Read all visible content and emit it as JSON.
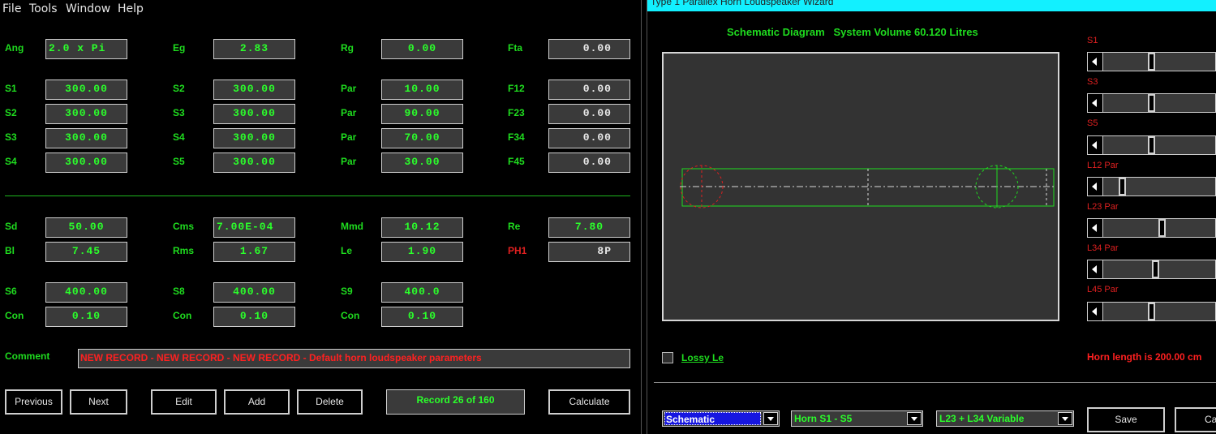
{
  "menu": [
    "File",
    "Tools",
    "Window",
    "Help"
  ],
  "params": {
    "ang_label": "Ang",
    "ang": "2.0 x Pi",
    "eg_label": "Eg",
    "eg": "2.83",
    "rg_label": "Rg",
    "rg": "0.00",
    "fta_label": "Fta",
    "fta": "0.00",
    "rows": [
      {
        "a_label": "S1",
        "a": "300.00",
        "b_label": "S2",
        "b": "300.00",
        "c_label": "Par",
        "c": "10.00",
        "d_label": "F12",
        "d": "0.00"
      },
      {
        "a_label": "S2",
        "a": "300.00",
        "b_label": "S3",
        "b": "300.00",
        "c_label": "Par",
        "c": "90.00",
        "d_label": "F23",
        "d": "0.00"
      },
      {
        "a_label": "S3",
        "a": "300.00",
        "b_label": "S4",
        "b": "300.00",
        "c_label": "Par",
        "c": "70.00",
        "d_label": "F34",
        "d": "0.00"
      },
      {
        "a_label": "S4",
        "a": "300.00",
        "b_label": "S5",
        "b": "300.00",
        "c_label": "Par",
        "c": "30.00",
        "d_label": "F45",
        "d": "0.00"
      }
    ]
  },
  "driver": {
    "sd_label": "Sd",
    "sd": "50.00",
    "cms_label": "Cms",
    "cms": "7.00E-04",
    "mmd_label": "Mmd",
    "mmd": "10.12",
    "re_label": "Re",
    "re": "7.80",
    "bl_label": "Bl",
    "bl": "7.45",
    "rms_label": "Rms",
    "rms": "1.67",
    "le_label": "Le",
    "le": "1.90",
    "ph1_label": "PH1",
    "ph1": "8P"
  },
  "chambers": {
    "s6_label": "S6",
    "s6": "400.00",
    "s8_label": "S8",
    "s8": "400.00",
    "s9_label": "S9",
    "s9": "400.0",
    "con_label": "Con",
    "con1": "0.10",
    "con2": "0.10",
    "con3": "0.10"
  },
  "comment_label": "Comment",
  "comment": "NEW RECORD - NEW RECORD - NEW RECORD - Default horn loudspeaker parameters",
  "buttons": {
    "previous": "Previous",
    "next": "Next",
    "edit": "Edit",
    "add": "Add",
    "delete": "Delete",
    "calculate": "Calculate"
  },
  "record": "Record 26 of 160",
  "wizard": {
    "title": "Type 1 Parallex Horn Loudspeaker Wizard",
    "schematic_title": "Schematic Diagram   System Volume 60.120 Litres",
    "sliders": [
      {
        "label": "S1",
        "pos": 0.42
      },
      {
        "label": "S3",
        "pos": 0.42
      },
      {
        "label": "S5",
        "pos": 0.42
      },
      {
        "label": "L12  Par",
        "pos": 0.14
      },
      {
        "label": "L23  Par",
        "pos": 0.52
      },
      {
        "label": "L34  Par",
        "pos": 0.46
      },
      {
        "label": "L45  Par",
        "pos": 0.42
      }
    ],
    "lossy_label": "Lossy Le",
    "lossy_checked": false,
    "horn_length": "Horn length is 200.00 cm",
    "combo1": "Schematic",
    "combo2": "Horn S1 - S5",
    "combo3": "L23 + L34 Variable",
    "save": "Save",
    "cancel": "Cancel"
  },
  "colors": {
    "accent_green": "#1fdc1f",
    "value_green": "#2bff2b",
    "warning_red": "#e02020",
    "title_cyan": "#12f0ff"
  }
}
